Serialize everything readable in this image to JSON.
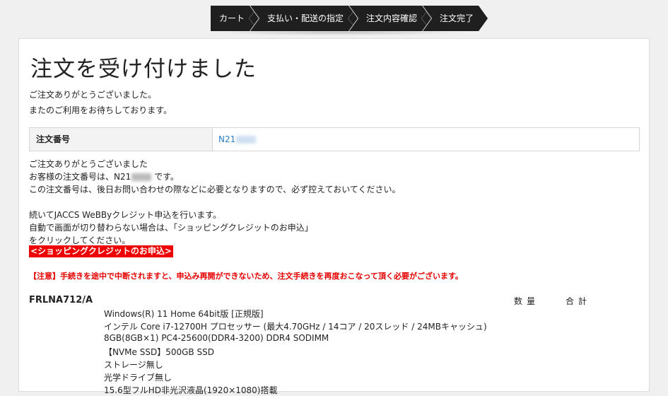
{
  "steps": [
    "カート",
    "支払い・配送の指定",
    "注文内容確認",
    "注文完了"
  ],
  "page_title": "注文を受け付けました",
  "thanks": [
    "ご注文ありがとうございました。",
    "またのご利用をお待ちしております。"
  ],
  "order": {
    "label": "注文番号",
    "number_prefix": "N21"
  },
  "message": {
    "line1": "ご注文ありがとうございました",
    "line2_prefix": "お客様の注文番号は、N21",
    "line2_suffix": "です。",
    "line3": "この注文番号は、後日お問い合わせの際などに必要となりますので、必ず控えておいてください。",
    "line4": "続いてJACCS WeBByクレジット申込を行います。",
    "line5": "自動で画面が切り替わらない場合は、「ショッピングクレジットのお申込」",
    "line6": "をクリックしてください。"
  },
  "apply_link": "<ショッピングクレジットのお申込>",
  "notice": "【注意】手続きを途中で中断されますと、申込み再開ができないため、注文手続きを再度おこなって頂く必要がございます。",
  "product": {
    "code": "FRLNA712/A",
    "col_qty": "数量",
    "col_total": "合計",
    "specs": [
      "Windows(R) 11 Home 64bit版 [正規版]",
      "インテル Core i7-12700H プロセッサー (最大4.70GHz / 14コア / 20スレッド / 24MBキャッシュ)",
      "8GB(8GB×1) PC4-25600(DDR4-3200) DDR4 SODIMM",
      "【NVMe SSD】500GB SSD",
      "ストレージ無し",
      "光学ドライブ無し",
      "15.6型フルHD非光沢液晶(1920×1080)搭載"
    ]
  }
}
